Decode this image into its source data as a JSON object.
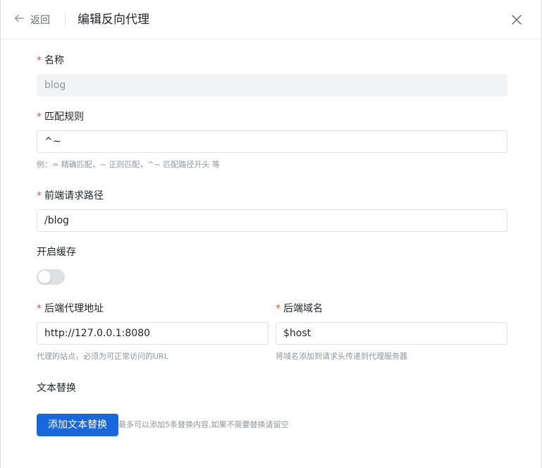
{
  "header": {
    "back_label": "返回",
    "title": "编辑反向代理"
  },
  "form": {
    "name": {
      "label": "名称",
      "required": "*",
      "value": "blog",
      "disabled": true
    },
    "match_rule": {
      "label": "匹配规则",
      "required": "*",
      "value": "^~",
      "hint": "例：= 精确匹配，~ 正则匹配，^~ 匹配路径开头 等"
    },
    "frontend_path": {
      "label": "前端请求路径",
      "required": "*",
      "value": "/blog"
    },
    "cache": {
      "label": "开启缓存",
      "enabled": false
    },
    "backend_address": {
      "label": "后端代理地址",
      "required": "*",
      "value": "http://127.0.0.1:8080",
      "hint": "代理的站点，必须为可正常访问的URL"
    },
    "backend_domain": {
      "label": "后端域名",
      "required": "*",
      "value": "$host",
      "hint": "将域名添加到请求头传递到代理服务器"
    },
    "text_replace": {
      "label": "文本替换",
      "button_label": "添加文本替换",
      "hint": "最多可以添加5条替换内容,如果不需要替换请留空"
    }
  },
  "colors": {
    "primary": "#1668dc",
    "required": "#f54a45",
    "hint": "#8f959e",
    "border": "#dee0e3"
  }
}
